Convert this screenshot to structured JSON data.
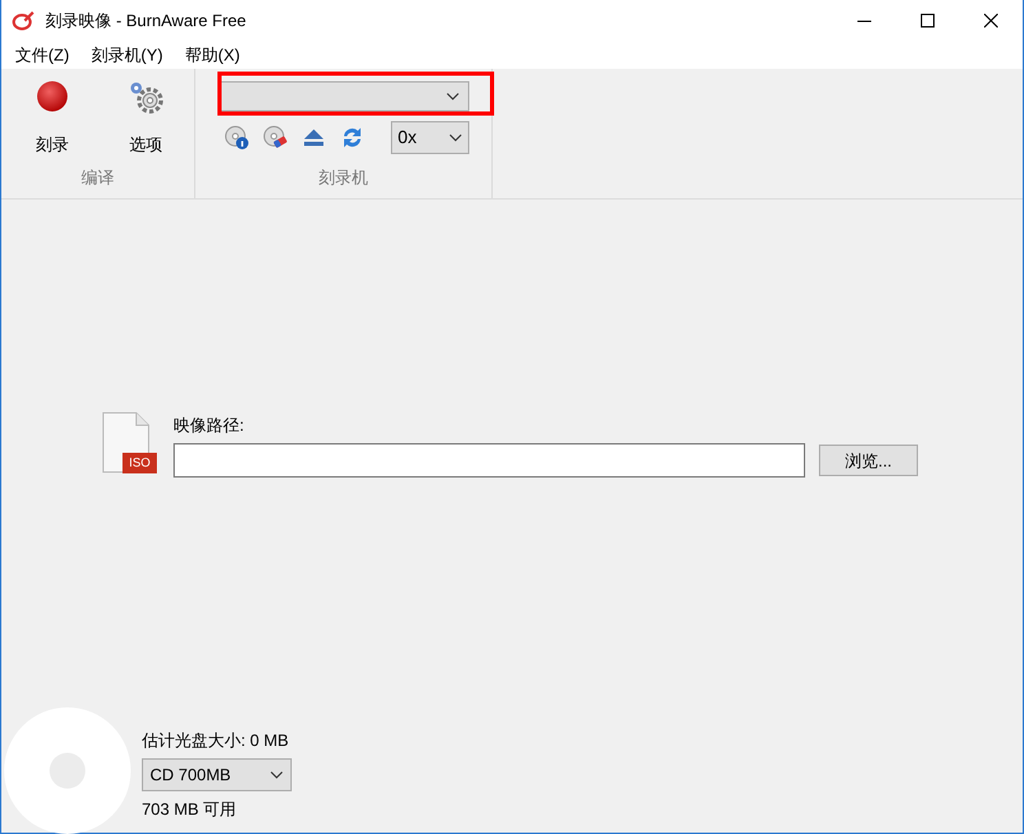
{
  "window": {
    "title": "刻录映像 - BurnAware Free"
  },
  "menu": [
    {
      "label": "文件(Z)"
    },
    {
      "label": "刻录机(Y)"
    },
    {
      "label": "帮助(X)"
    }
  ],
  "ribbon": {
    "groups": [
      {
        "label": "编译",
        "buttons": [
          {
            "label": "刻录",
            "kind": "burn"
          },
          {
            "label": "选项",
            "kind": "options"
          }
        ]
      },
      {
        "label": "刻录机",
        "drive_select": {
          "highlighted": true
        },
        "tools": [
          {
            "kind": "disc-info"
          },
          {
            "kind": "disc-erase"
          },
          {
            "kind": "eject"
          },
          {
            "kind": "refresh"
          }
        ],
        "speed": "0x"
      }
    ]
  },
  "image_path": {
    "label": "映像路径:",
    "file_badge": "ISO",
    "browse": "浏览..."
  },
  "disc": {
    "estimate": "估计光盘大小: 0 MB",
    "media": "CD 700MB",
    "free": "703 MB 可用"
  }
}
